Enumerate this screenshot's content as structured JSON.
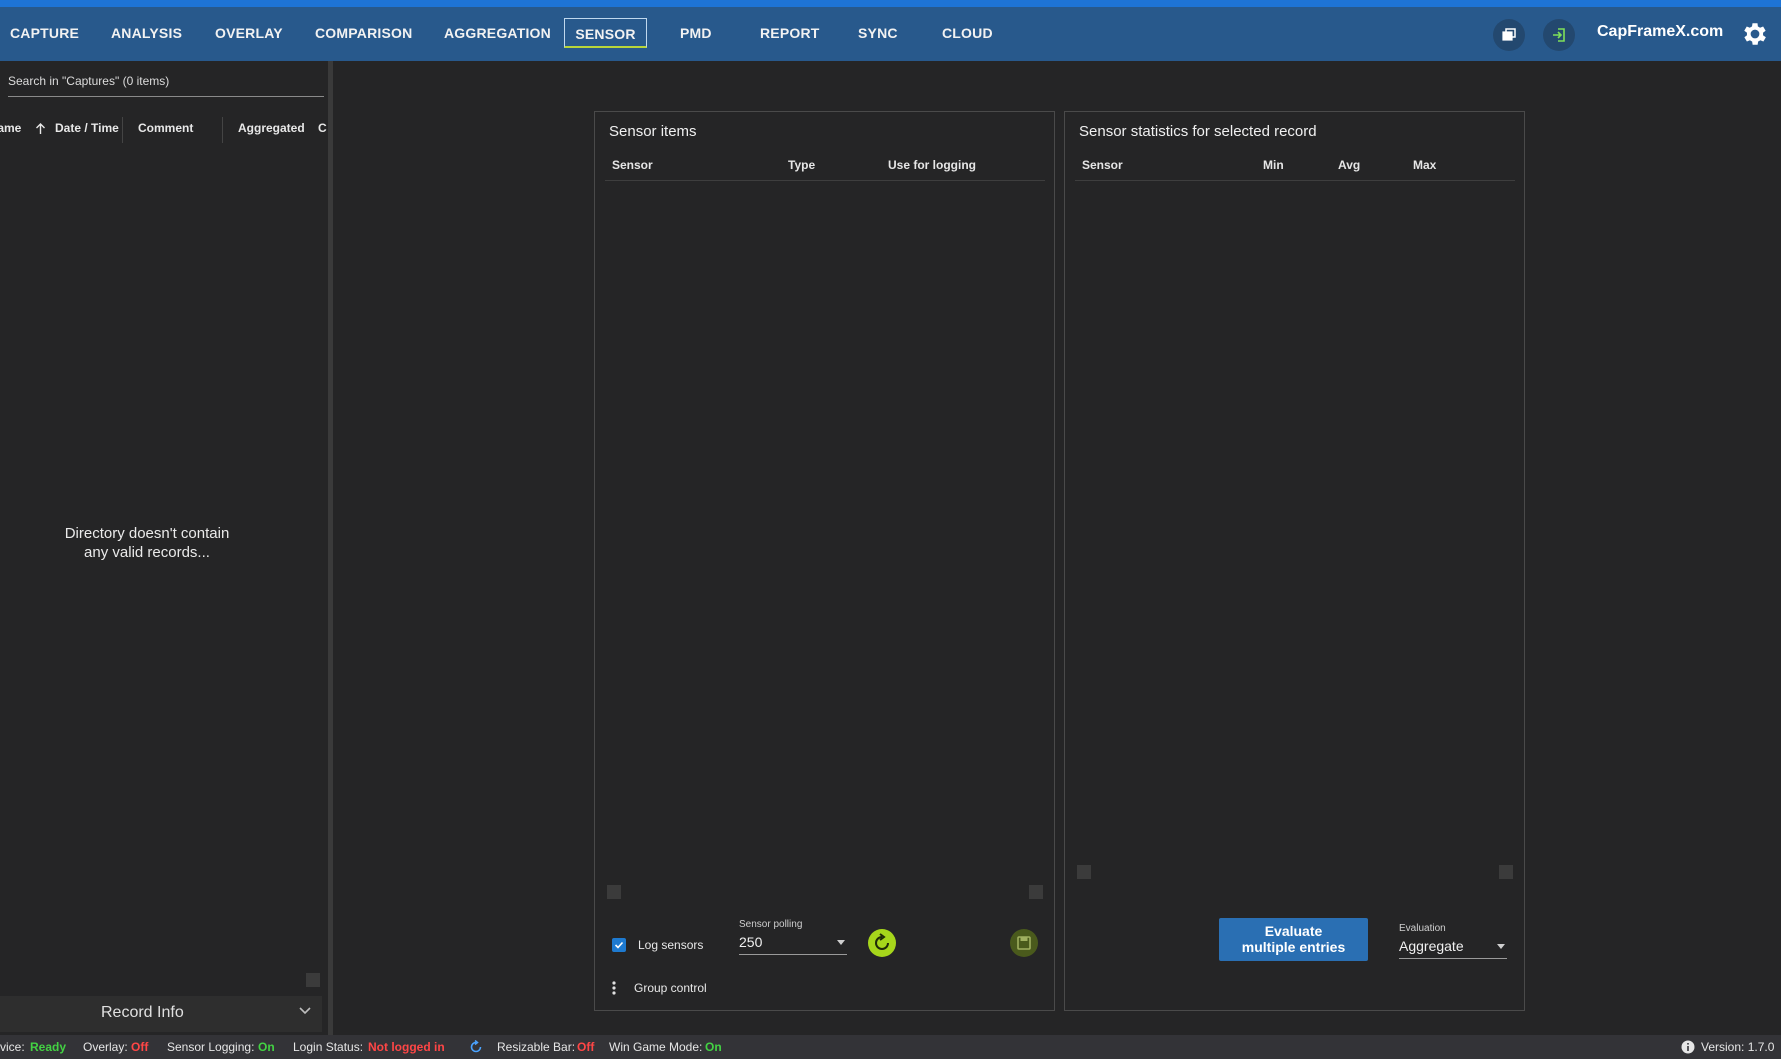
{
  "nav": {
    "tabs": [
      "CAPTURE",
      "ANALYSIS",
      "OVERLAY",
      "COMPARISON",
      "AGGREGATION",
      "SENSOR",
      "PMD",
      "REPORT",
      "SYNC",
      "CLOUD"
    ],
    "active_tab": "SENSOR",
    "brand": "CapFrameX.com",
    "icons": [
      "windows-icon",
      "login-icon",
      "gear-icon"
    ],
    "accent_color": "#1e74d6",
    "bar_color": "#28598c"
  },
  "left_panel": {
    "search_placeholder": "Search in \"Captures\" (0 items)",
    "columns": [
      "Game",
      "Date / Time",
      "Comment",
      "Aggregated",
      "C"
    ],
    "empty_message_line1": "Directory doesn't contain",
    "empty_message_line2": "any valid records...",
    "record_info": "Record Info"
  },
  "sensor_items": {
    "title": "Sensor items",
    "columns": [
      "Sensor",
      "Type",
      "Use for logging"
    ],
    "log_sensors_label": "Log sensors",
    "log_sensors_checked": true,
    "polling_label": "Sensor polling",
    "polling_value": "250",
    "group_control": "Group control"
  },
  "sensor_stats": {
    "title": "Sensor statistics for selected record",
    "columns": [
      "Sensor",
      "Min",
      "Avg",
      "Max"
    ],
    "evaluate_button_line1": "Evaluate",
    "evaluate_button_line2": "multiple entries",
    "evaluation_label": "Evaluation",
    "evaluation_value": "Aggregate"
  },
  "status_bar": {
    "service_label": "vice:",
    "service_value": "Ready",
    "overlay_label": "Overlay:",
    "overlay_value": "Off",
    "sensor_logging_label": "Sensor Logging:",
    "sensor_logging_value": "On",
    "login_label": "Login Status:",
    "login_value": "Not logged in",
    "resizable_bar_label": "Resizable Bar:",
    "resizable_bar_value": "Off",
    "win_game_mode_label": "Win Game Mode:",
    "win_game_mode_value": "On",
    "version_label": "Version: 1.7.0"
  }
}
